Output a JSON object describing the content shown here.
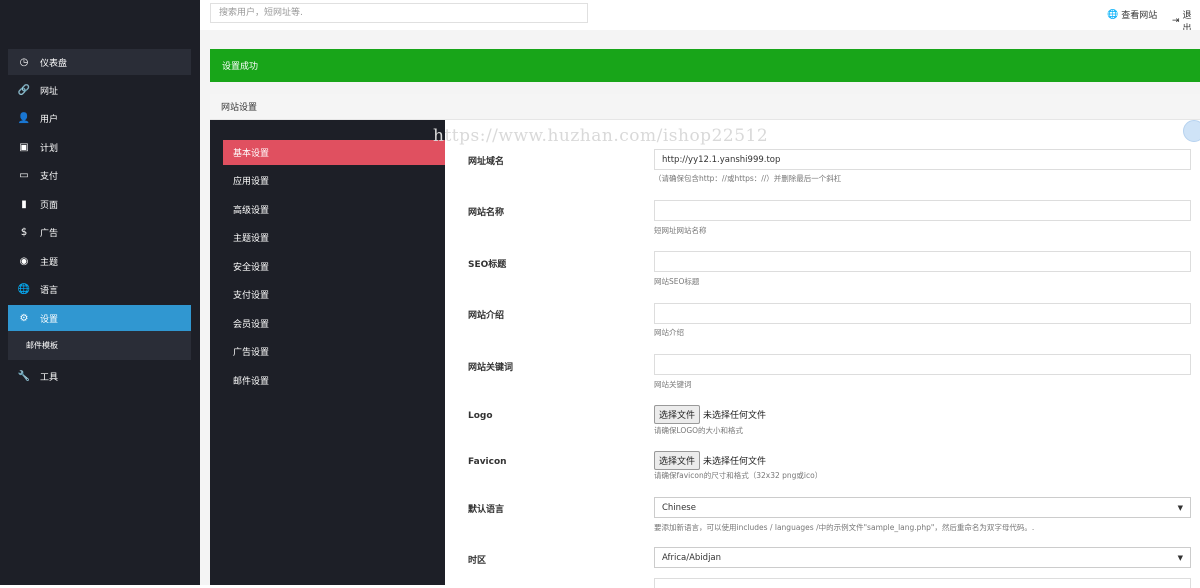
{
  "header": {
    "search_placeholder": "搜索用户，短网址等.",
    "view_site": "查看网站",
    "logout": "退出"
  },
  "sidebar": {
    "items": [
      {
        "label": "仪表盘",
        "icon": "dashboard-icon"
      },
      {
        "label": "网址",
        "icon": "link-icon"
      },
      {
        "label": "用户",
        "icon": "user-icon"
      },
      {
        "label": "计划",
        "icon": "briefcase-icon"
      },
      {
        "label": "支付",
        "icon": "credit-card-icon"
      },
      {
        "label": "页面",
        "icon": "file-icon"
      },
      {
        "label": "广告",
        "icon": "dollar-icon"
      },
      {
        "label": "主题",
        "icon": "eye-icon"
      },
      {
        "label": "语言",
        "icon": "globe-icon"
      },
      {
        "label": "设置",
        "icon": "gear-icon"
      },
      {
        "label": "工具",
        "icon": "wrench-icon"
      }
    ],
    "sub_item": "邮件模板",
    "active": "设置"
  },
  "alert": {
    "text": "设置成功"
  },
  "panel": {
    "title": "网站设置"
  },
  "tabs": [
    "基本设置",
    "应用设置",
    "高级设置",
    "主题设置",
    "安全设置",
    "支付设置",
    "会员设置",
    "广告设置",
    "邮件设置"
  ],
  "form": {
    "url": {
      "label": "网址域名",
      "value": "http://yy12.1.yanshi999.top",
      "help": "（请确保包含http：//或https：//）并删除最后一个斜杠"
    },
    "name": {
      "label": "网站名称",
      "value": "",
      "help": "短网址网站名称"
    },
    "seo": {
      "label": "SEO标题",
      "value": "",
      "help": "网站SEO标题"
    },
    "intro": {
      "label": "网站介绍",
      "value": "",
      "help": "网站介绍"
    },
    "keywords": {
      "label": "网站关键词",
      "value": "",
      "help": "网站关键词"
    },
    "logo": {
      "label": "Logo",
      "button": "选择文件",
      "status": "未选择任何文件",
      "help": "请确保LOGO的大小和格式"
    },
    "favicon": {
      "label": "Favicon",
      "button": "选择文件",
      "status": "未选择任何文件",
      "help": "请确保favicon的尺寸和格式（32x32 png或ico）"
    },
    "language": {
      "label": "默认语言",
      "value": "Chinese",
      "help": "要添加新语言，可以使用includes / languages /中的示例文件\"sample_lang.php\"，然后重命名为双字母代码。."
    },
    "timezone": {
      "label": "时区",
      "value": "Africa/Abidjan"
    }
  },
  "watermark": "https://www.huzhan.com/ishop22512",
  "colors": {
    "sidebar_bg": "#1d1f27",
    "active_blue": "#3097d1",
    "success_green": "#18a519",
    "active_tab": "#e05060"
  }
}
